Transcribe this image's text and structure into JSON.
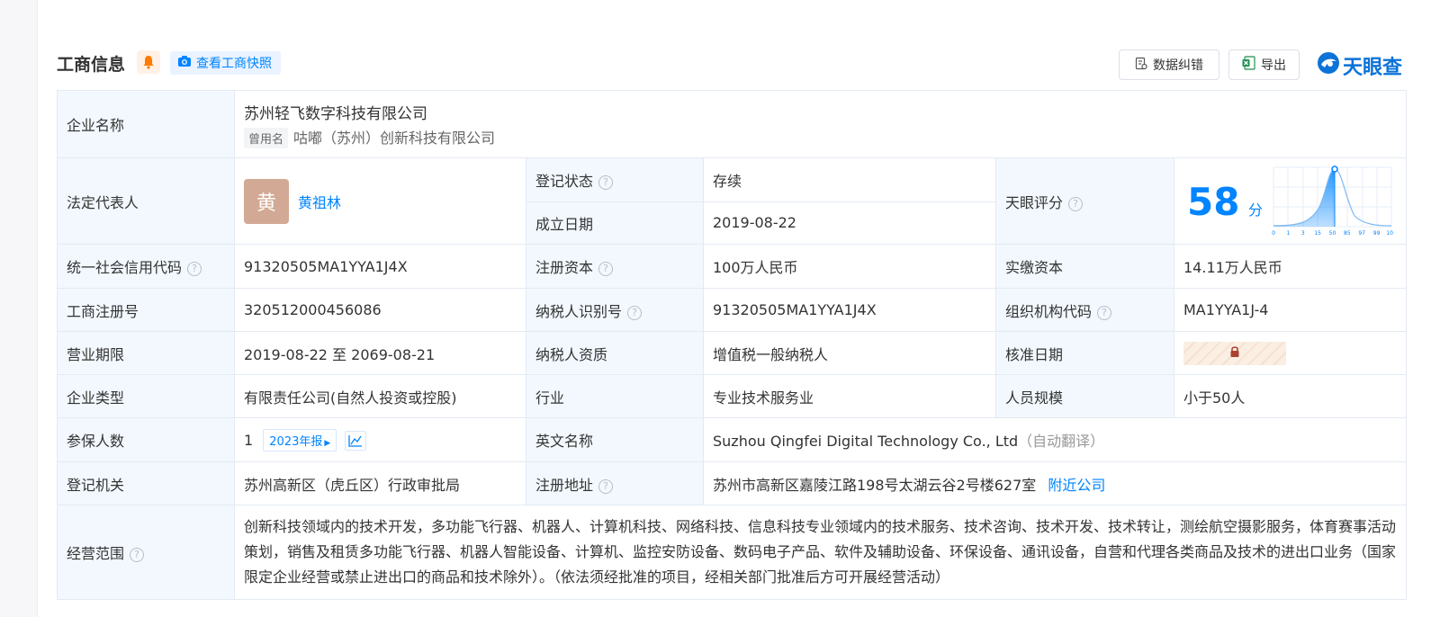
{
  "header": {
    "title": "工商信息",
    "snapshot_label": "查看工商快照",
    "correct_label": "数据纠错",
    "export_label": "导出",
    "logo_text": "天眼查",
    "colors": {
      "accent": "#0084ff",
      "bell": "#ff7a00",
      "excel": "#1f8f4e"
    }
  },
  "labels": {
    "company_name": "企业名称",
    "legal_rep": "法定代表人",
    "reg_status": "登记状态",
    "founded": "成立日期",
    "tianyan_score": "天眼评分",
    "credit_code": "统一社会信用代码",
    "reg_capital": "注册资本",
    "paid_capital": "实缴资本",
    "biz_reg_no": "工商注册号",
    "taxpayer_id": "纳税人识别号",
    "org_code": "组织机构代码",
    "biz_term": "营业期限",
    "taxpayer_qual": "纳税人资质",
    "approval_date": "核准日期",
    "company_type": "企业类型",
    "industry": "行业",
    "staff_size": "人员规模",
    "insured": "参保人数",
    "english_name": "英文名称",
    "reg_authority": "登记机关",
    "reg_address": "注册地址",
    "biz_scope": "经营范围",
    "help_mark": "?"
  },
  "values": {
    "company_name": "苏州轻飞数字科技有限公司",
    "former_name_tag": "曾用名",
    "former_name": "咕嘟（苏州）创新科技有限公司",
    "avatar_char": "黄",
    "legal_rep": "黄祖林",
    "reg_status": "存续",
    "founded": "2019-08-22",
    "score": "58",
    "score_unit": "分",
    "score_axis": [
      "0",
      "1",
      "3",
      "15",
      "50",
      "85",
      "97",
      "99",
      "100"
    ],
    "credit_code": "91320505MA1YYA1J4X",
    "reg_capital": "100万人民币",
    "paid_capital": "14.11万人民币",
    "biz_reg_no": "320512000456086",
    "taxpayer_id": "91320505MA1YYA1J4X",
    "org_code": "MA1YYA1J-4",
    "biz_term": "2019-08-22 至 2069-08-21",
    "taxpayer_qual": "增值税一般纳税人",
    "company_type": "有限责任公司(自然人投资或控股)",
    "industry": "专业技术服务业",
    "staff_size": "小于50人",
    "insured": "1",
    "insured_report": "2023年报",
    "english_name": "Suzhou Qingfei Digital Technology Co., Ltd",
    "english_note": "（自动翻译）",
    "reg_authority": "苏州高新区（虎丘区）行政审批局",
    "reg_address": "苏州市高新区嘉陵江路198号太湖云谷2号楼627室",
    "nearby_link": "附近公司",
    "biz_scope": "创新科技领域内的技术开发，多功能飞行器、机器人、计算机科技、网络科技、信息科技专业领域内的技术服务、技术咨询、技术开发、技术转让，测绘航空摄影服务，体育赛事活动策划，销售及租赁多功能飞行器、机器人智能设备、计算机、监控安防设备、数码电子产品、软件及辅助设备、环保设备、通讯设备，自营和代理各类商品及技术的进出口业务（国家限定企业经营或禁止进出口的商品和技术除外）。（依法须经批准的项目，经相关部门批准后方可开展经营活动）"
  }
}
